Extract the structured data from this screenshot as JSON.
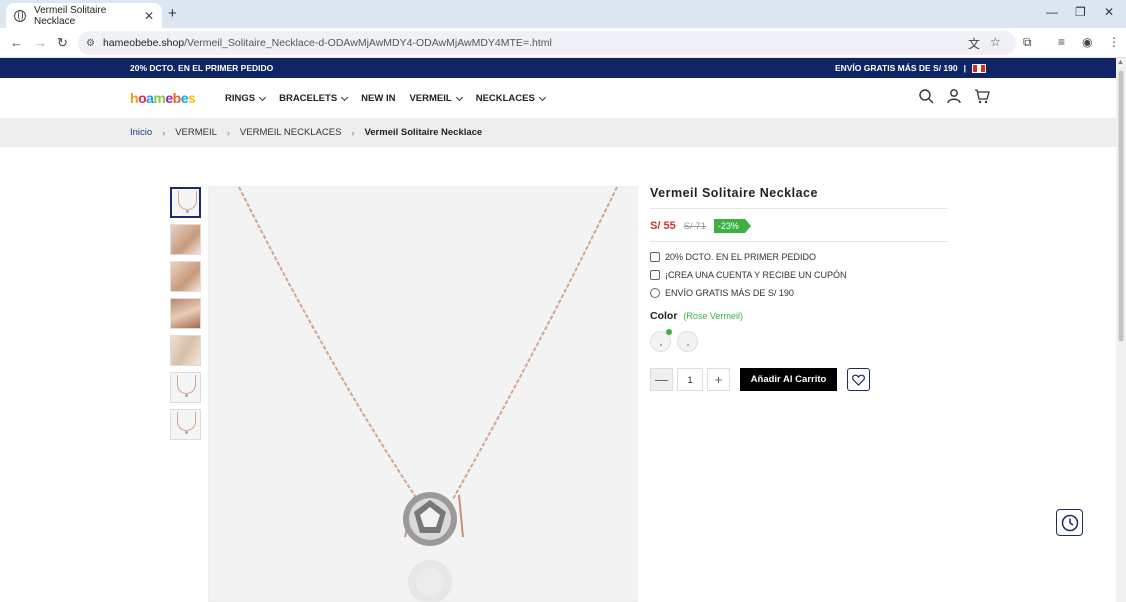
{
  "browser": {
    "tab_title": "Vermeil Solitaire Necklace",
    "url_host": "hameobebe.shop",
    "url_path": "/Vermeil_Solitaire_Necklace-d-ODAwMjAwMDY4-ODAwMjAwMDY4MTE=.html"
  },
  "promo": {
    "left": "20% DCTO. EN EL PRIMER PEDIDO",
    "right": "ENVÍO GRATIS MÁS DE S/ 190",
    "divider": "|"
  },
  "header": {
    "logo_letters": [
      "h",
      "o",
      "a",
      "m",
      "e",
      "b",
      "e",
      "s"
    ],
    "nav": [
      {
        "label": "RINGS",
        "has_dropdown": true
      },
      {
        "label": "BRACELETS",
        "has_dropdown": true
      },
      {
        "label": "NEW IN",
        "has_dropdown": false
      },
      {
        "label": "VERMEIL",
        "has_dropdown": true
      },
      {
        "label": "NECKLACES",
        "has_dropdown": true
      }
    ]
  },
  "breadcrumb": {
    "home": "Inicio",
    "level1": "VERMEIL",
    "level2": "VERMEIL NECKLACES",
    "current": "Vermeil Solitaire Necklace",
    "separator": "›"
  },
  "product": {
    "title": "Vermeil Solitaire Necklace",
    "price": "S/ 55",
    "old_price": "S/ 71",
    "discount": "-23%",
    "perks": [
      "20% DCTO. EN EL PRIMER PEDIDO",
      "¡CREA UNA CUENTA Y RECIBE UN CUPÓN",
      "ENVÍO GRATIS MÁS DE S/ 190"
    ],
    "color_label": "Color",
    "color_selected": "(Rose Vermeil)",
    "quantity": "1",
    "add_to_cart": "Añadir Al Carrito"
  },
  "colors": {
    "promo_bg": "#0f2565",
    "price": "#c0392b",
    "discount_bg": "#3cb043",
    "chain": "#d4a58a"
  }
}
